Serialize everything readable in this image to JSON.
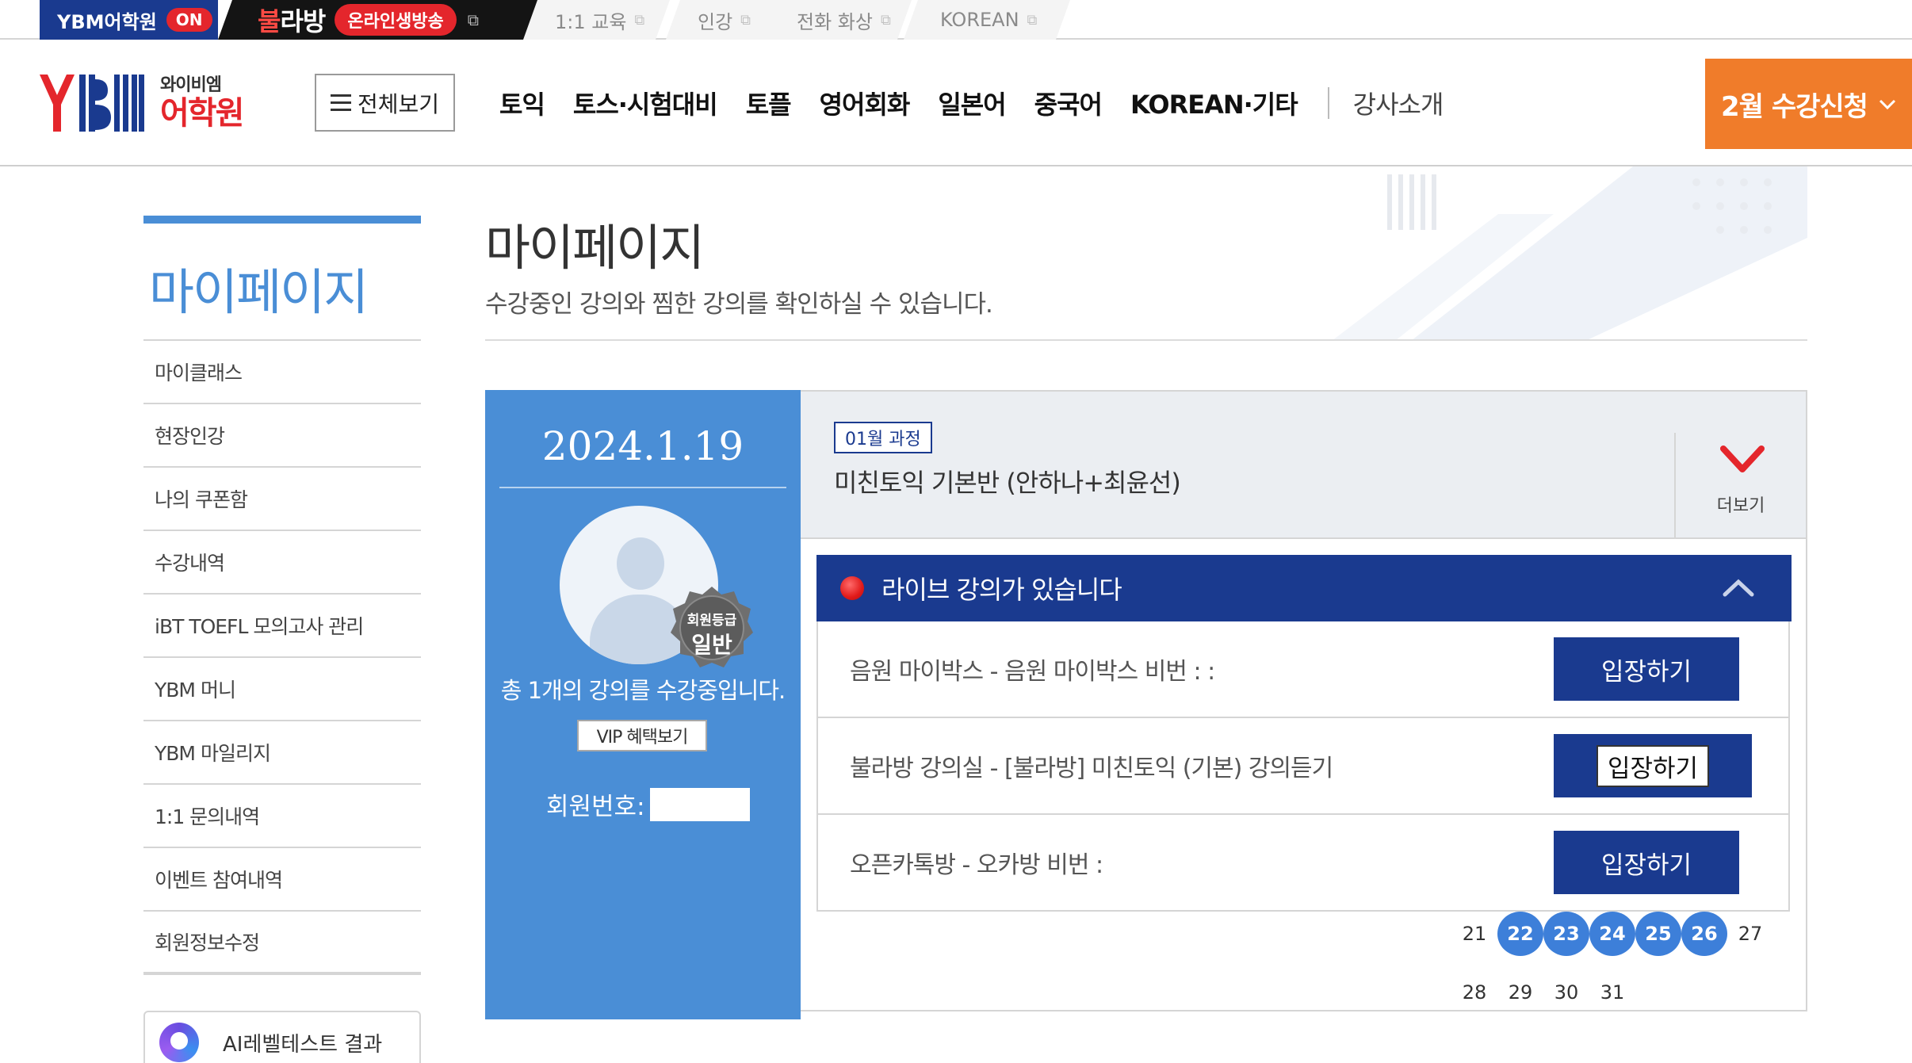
{
  "topbar": {
    "ybm_label": "YBM어학원",
    "ybm_on": "ON",
    "bul_logo_a": "불",
    "bul_logo_b": "라방",
    "bul_pill": "온라인생방송",
    "tabs": [
      "1:1 교육",
      "인강",
      "전화 화상",
      "KOREAN"
    ]
  },
  "header": {
    "brand_sub": "와이비엠",
    "brand_main": "어학원",
    "all_menu": "전체보기",
    "nav": [
      "토익",
      "토스·시험대비",
      "토플",
      "영어회화",
      "일본어",
      "중국어",
      "KOREAN·기타"
    ],
    "nav_plain": "강사소개",
    "cta": "2월 수강신청"
  },
  "sidebar": {
    "title": "마이페이지",
    "items": [
      "마이클래스",
      "현장인강",
      "나의 쿠폰함",
      "수강내역",
      "iBT TOEFL 모의고사 관리",
      "YBM 머니",
      "YBM 마일리지",
      "1:1 문의내역",
      "이벤트 참여내역",
      "회원정보수정"
    ],
    "ai_box": "AI레벨테스트 결과"
  },
  "page": {
    "title": "마이페이지",
    "desc": "수강중인 강의와 찜한 강의를 확인하실 수 있습니다."
  },
  "profile": {
    "date": "2024.1.19",
    "grade_label": "회원등급",
    "grade": "일반",
    "course_count": "총 1개의 강의를 수강중입니다.",
    "vip": "VIP 혜택보기",
    "member_no": "회원번호:"
  },
  "course": {
    "month_badge": "01월 과정",
    "name": "미친토익 기본반 (안하나+최윤선)",
    "more": "더보기",
    "live_title": "라이브 강의가 있습니다",
    "rows": [
      {
        "text": "음원 마이박스 - 음원 마이박스 비번 : :",
        "button": "입장하기"
      },
      {
        "text": "불라방 강의실 - [불라방] 미친토익 (기본) 강의듣기",
        "button": "입장하기"
      },
      {
        "text": "오픈카톡방 - 오카방 비번 :",
        "button": "입장하기"
      }
    ]
  },
  "calendar": {
    "row1": [
      "21",
      "22",
      "23",
      "24",
      "25",
      "26",
      "27"
    ],
    "row2": [
      "28",
      "29",
      "30",
      "31"
    ],
    "active": [
      "22",
      "23",
      "24",
      "25",
      "26"
    ]
  },
  "colors": {
    "navy": "#1a3a8f",
    "blue": "#4a8ed6",
    "orange": "#f07c2a",
    "red": "#e4262c",
    "active_day": "#3d7fd9"
  }
}
